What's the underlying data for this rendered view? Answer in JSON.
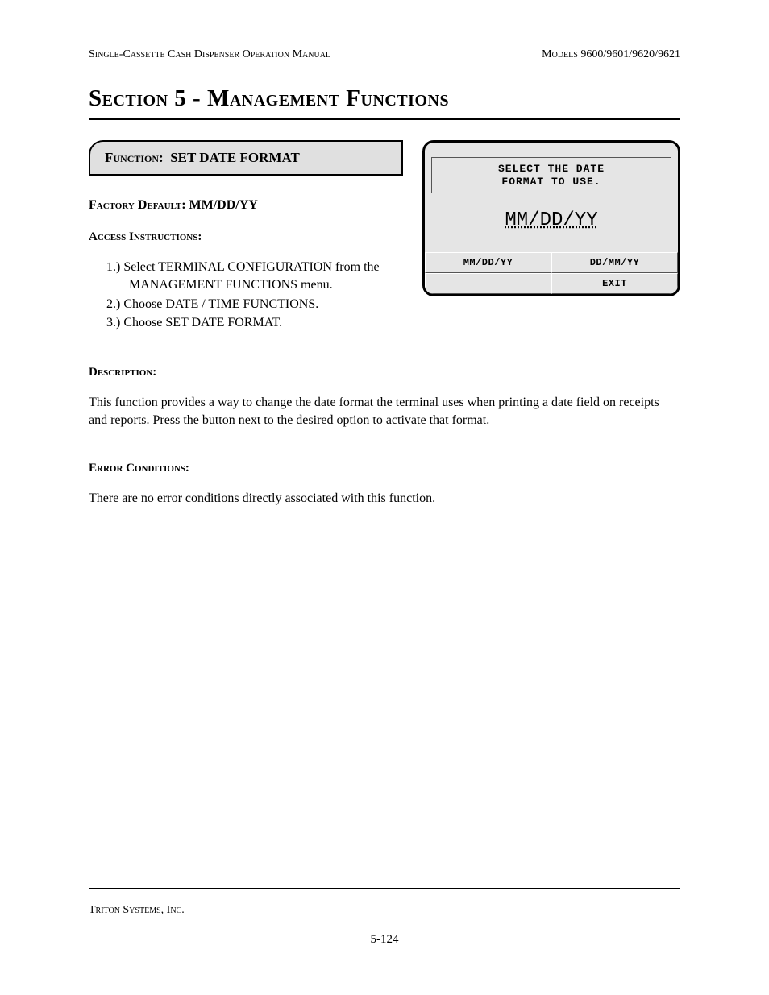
{
  "header": {
    "left": "Single-Cassette Cash Dispenser Operation Manual",
    "right": "Models 9600/9601/9620/9621"
  },
  "section_title": "Section 5 - Management Functions",
  "function_box": {
    "label": "Function:",
    "name": "SET DATE FORMAT"
  },
  "factory_default": {
    "label": "Factory Default:",
    "value": "MM/DD/YY"
  },
  "access_instructions": {
    "label": "Access Instructions:",
    "items": [
      "1.)  Select TERMINAL CONFIGURATION from the MANAGEMENT FUNCTIONS menu.",
      "2.)  Choose DATE / TIME FUNCTIONS.",
      "3.)  Choose SET DATE FORMAT."
    ]
  },
  "terminal": {
    "prompt_line1": "SELECT THE DATE",
    "prompt_line2": "FORMAT TO USE.",
    "current": "MM/DD/YY",
    "button_left": "MM/DD/YY",
    "button_right_top": "DD/MM/YY",
    "button_right_bottom": "EXIT",
    "blank": " "
  },
  "description": {
    "label": "Description:",
    "text": "This function provides a way to change the date format the terminal uses when printing a date field on receipts and reports. Press the button next to the desired option to activate that format."
  },
  "error_conditions": {
    "label": "Error Conditions:",
    "text": "There are no error conditions directly associated with this function."
  },
  "footer": {
    "company": "Triton Systems, Inc.",
    "page": "5-124"
  }
}
